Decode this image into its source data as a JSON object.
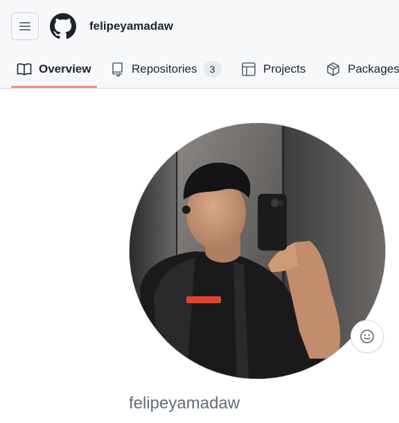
{
  "header": {
    "username": "felipeyamadaw",
    "menu_icon": "hamburger-icon",
    "logo_icon": "github-mark-icon"
  },
  "tabs": [
    {
      "label": "Overview",
      "icon": "book-icon",
      "active": true
    },
    {
      "label": "Repositories",
      "icon": "repo-icon",
      "count": "3"
    },
    {
      "label": "Projects",
      "icon": "table-icon"
    },
    {
      "label": "Packages",
      "icon": "package-icon"
    }
  ],
  "profile": {
    "login": "felipeyamadaw",
    "status_icon": "smiley-icon"
  },
  "colors": {
    "header_bg": "#f6f8fa",
    "active_tab_underline": "#fd8c73",
    "text_primary": "#1f2328",
    "text_muted": "#636c76",
    "counter_bg": "#e7eaed",
    "border": "#d0d7de"
  }
}
